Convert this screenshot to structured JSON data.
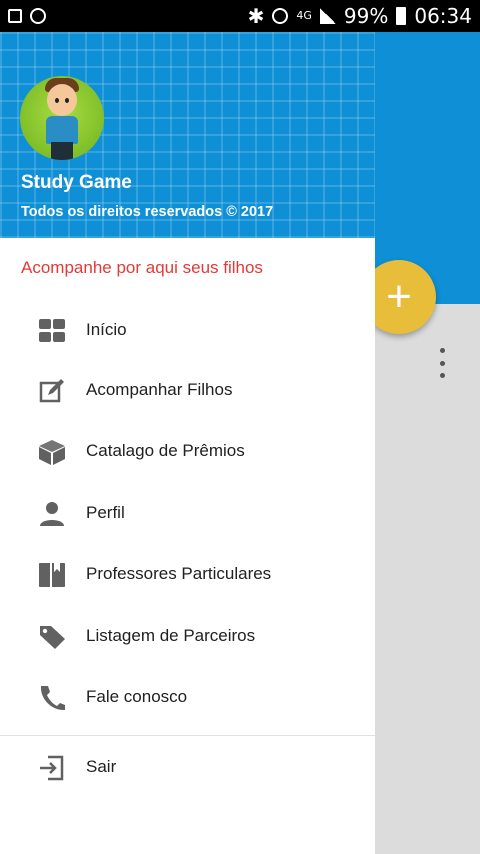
{
  "status_bar": {
    "battery": "99%",
    "time": "06:34",
    "network": "4G"
  },
  "drawer": {
    "header": {
      "app_name": "Study Game",
      "copyright": "Todos os direitos reservados © 2017"
    },
    "subtitle": "Acompanhe por aqui seus filhos",
    "menu": [
      {
        "label": "Início",
        "icon": "dashboard-icon"
      },
      {
        "label": "Acompanhar Filhos",
        "icon": "edit-icon"
      },
      {
        "label": "Catalago de Prêmios",
        "icon": "box-icon"
      },
      {
        "label": "Perfil",
        "icon": "person-icon"
      },
      {
        "label": "Professores Particulares",
        "icon": "book-icon"
      },
      {
        "label": "Listagem de Parceiros",
        "icon": "tag-icon"
      },
      {
        "label": "Fale conosco",
        "icon": "phone-icon"
      }
    ],
    "logout": {
      "label": "Sair",
      "icon": "logout-icon"
    }
  },
  "fab": {
    "label": "+"
  },
  "colors": {
    "primary": "#0e8fd6",
    "accent": "#e8bd3a",
    "subtitle": "#e53935"
  }
}
